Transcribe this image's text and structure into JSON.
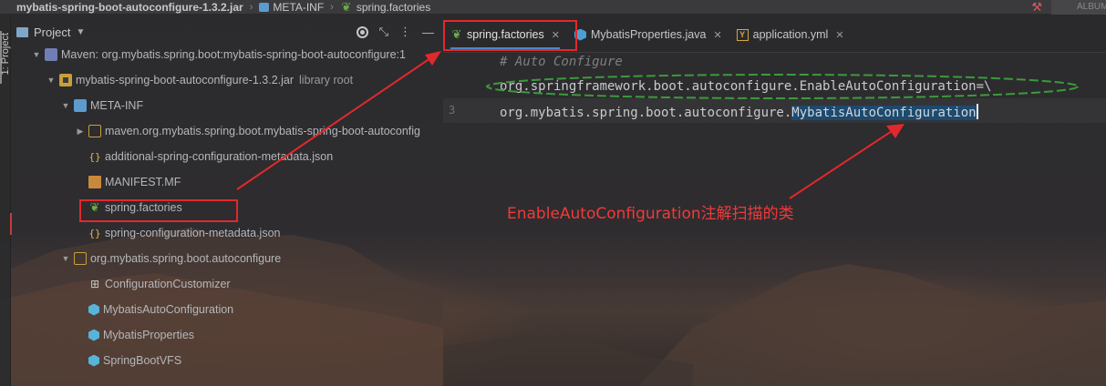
{
  "breadcrumb": {
    "items": [
      "mybatis-spring-boot-autoconfigure-1.3.2.jar",
      "META-INF",
      "spring.factories"
    ],
    "right_label": "ALBUM"
  },
  "tool_stripe": {
    "label": "1: Project"
  },
  "project_panel": {
    "title": "Project",
    "tree": [
      {
        "label": "Maven: org.mybatis.spring.boot:mybatis-spring-boot-autoconfigure:1",
        "icon": "maven-icon",
        "depth": 0,
        "arrow": "down"
      },
      {
        "label": "mybatis-spring-boot-autoconfigure-1.3.2.jar",
        "suffix": "library root",
        "icon": "jar-icon",
        "depth": 1,
        "arrow": "down"
      },
      {
        "label": "META-INF",
        "icon": "folder-icon",
        "depth": 2,
        "arrow": "down"
      },
      {
        "label": "maven.org.mybatis.spring.boot.mybatis-spring-boot-autoconfig",
        "icon": "package-folder-icon",
        "depth": 3,
        "arrow": "right"
      },
      {
        "label": "additional-spring-configuration-metadata.json",
        "icon": "json-file-icon",
        "depth": 3,
        "arrow": ""
      },
      {
        "label": "MANIFEST.MF",
        "icon": "manifest-file-icon",
        "depth": 3,
        "arrow": ""
      },
      {
        "label": "spring.factories",
        "icon": "spring-file-icon",
        "depth": 3,
        "arrow": ""
      },
      {
        "label": "spring-configuration-metadata.json",
        "icon": "json-file-icon",
        "depth": 3,
        "arrow": ""
      },
      {
        "label": "org.mybatis.spring.boot.autoconfigure",
        "icon": "package-icon",
        "depth": 2,
        "arrow": "down"
      },
      {
        "label": "ConfigurationCustomizer",
        "icon": "interface-icon",
        "depth": 3,
        "arrow": ""
      },
      {
        "label": "MybatisAutoConfiguration",
        "icon": "class-icon",
        "depth": 3,
        "arrow": ""
      },
      {
        "label": "MybatisProperties",
        "icon": "class-icon",
        "depth": 3,
        "arrow": ""
      },
      {
        "label": "SpringBootVFS",
        "icon": "class-icon",
        "depth": 3,
        "arrow": ""
      }
    ]
  },
  "editor": {
    "tabs": [
      {
        "label": "spring.factories",
        "icon": "spring-file-icon",
        "active": true
      },
      {
        "label": "MybatisProperties.java",
        "icon": "java-class-icon",
        "active": false
      },
      {
        "label": "application.yml",
        "icon": "yaml-file-icon",
        "active": false
      }
    ],
    "lines": [
      {
        "number": "",
        "text": "# Auto Configure"
      },
      {
        "number": "",
        "text": "org.springframework.boot.autoconfigure.EnableAutoConfiguration=\\"
      },
      {
        "number": "3",
        "text_before": "org.mybatis.spring.boot.autoconfigure.",
        "text_selected": "MybatisAutoConfiguration"
      }
    ]
  },
  "annotation": {
    "text": "EnableAutoConfiguration注解扫描的类",
    "color": "#f03a3a"
  },
  "colors": {
    "accent_red": "#e0292c",
    "selection": "#1d4a6e",
    "tab_underline": "#4a88c7"
  }
}
